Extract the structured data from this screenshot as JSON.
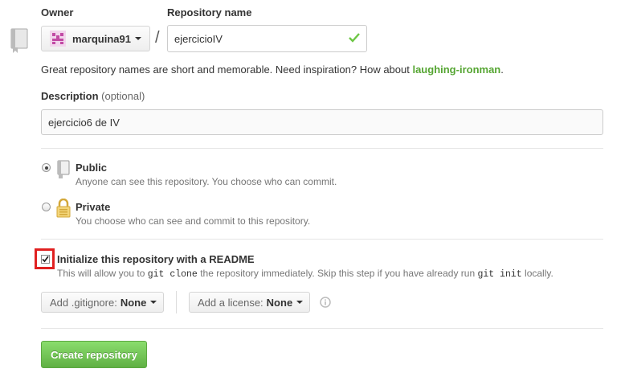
{
  "owner": {
    "label": "Owner",
    "value": "marquina91"
  },
  "repository": {
    "label": "Repository name",
    "value": "ejercicioIV",
    "separator": "/"
  },
  "hint": {
    "prefix": "Great repository names are short and memorable. Need inspiration? How about ",
    "suggestion": "laughing-ironman",
    "suffix": "."
  },
  "description": {
    "label": "Description",
    "optional": "(optional)",
    "value": "ejercicio6 de IV"
  },
  "visibility": {
    "public": {
      "title": "Public",
      "desc": "Anyone can see this repository. You choose who can commit.",
      "checked": true
    },
    "private": {
      "title": "Private",
      "desc": "You choose who can see and commit to this repository.",
      "checked": false
    }
  },
  "readme": {
    "title": "Initialize this repository with a README",
    "desc_1": "This will allow you to",
    "code_1": "git clone",
    "desc_2": "the repository immediately. Skip this step if you have already run",
    "code_2": "git init",
    "desc_3": "locally.",
    "checked": true
  },
  "gitignore": {
    "label": "Add .gitignore:",
    "value": "None"
  },
  "license": {
    "label": "Add a license:",
    "value": "None"
  },
  "create_button": "Create repository",
  "colors": {
    "accent_green": "#55a532",
    "highlight_red": "#e02020"
  }
}
